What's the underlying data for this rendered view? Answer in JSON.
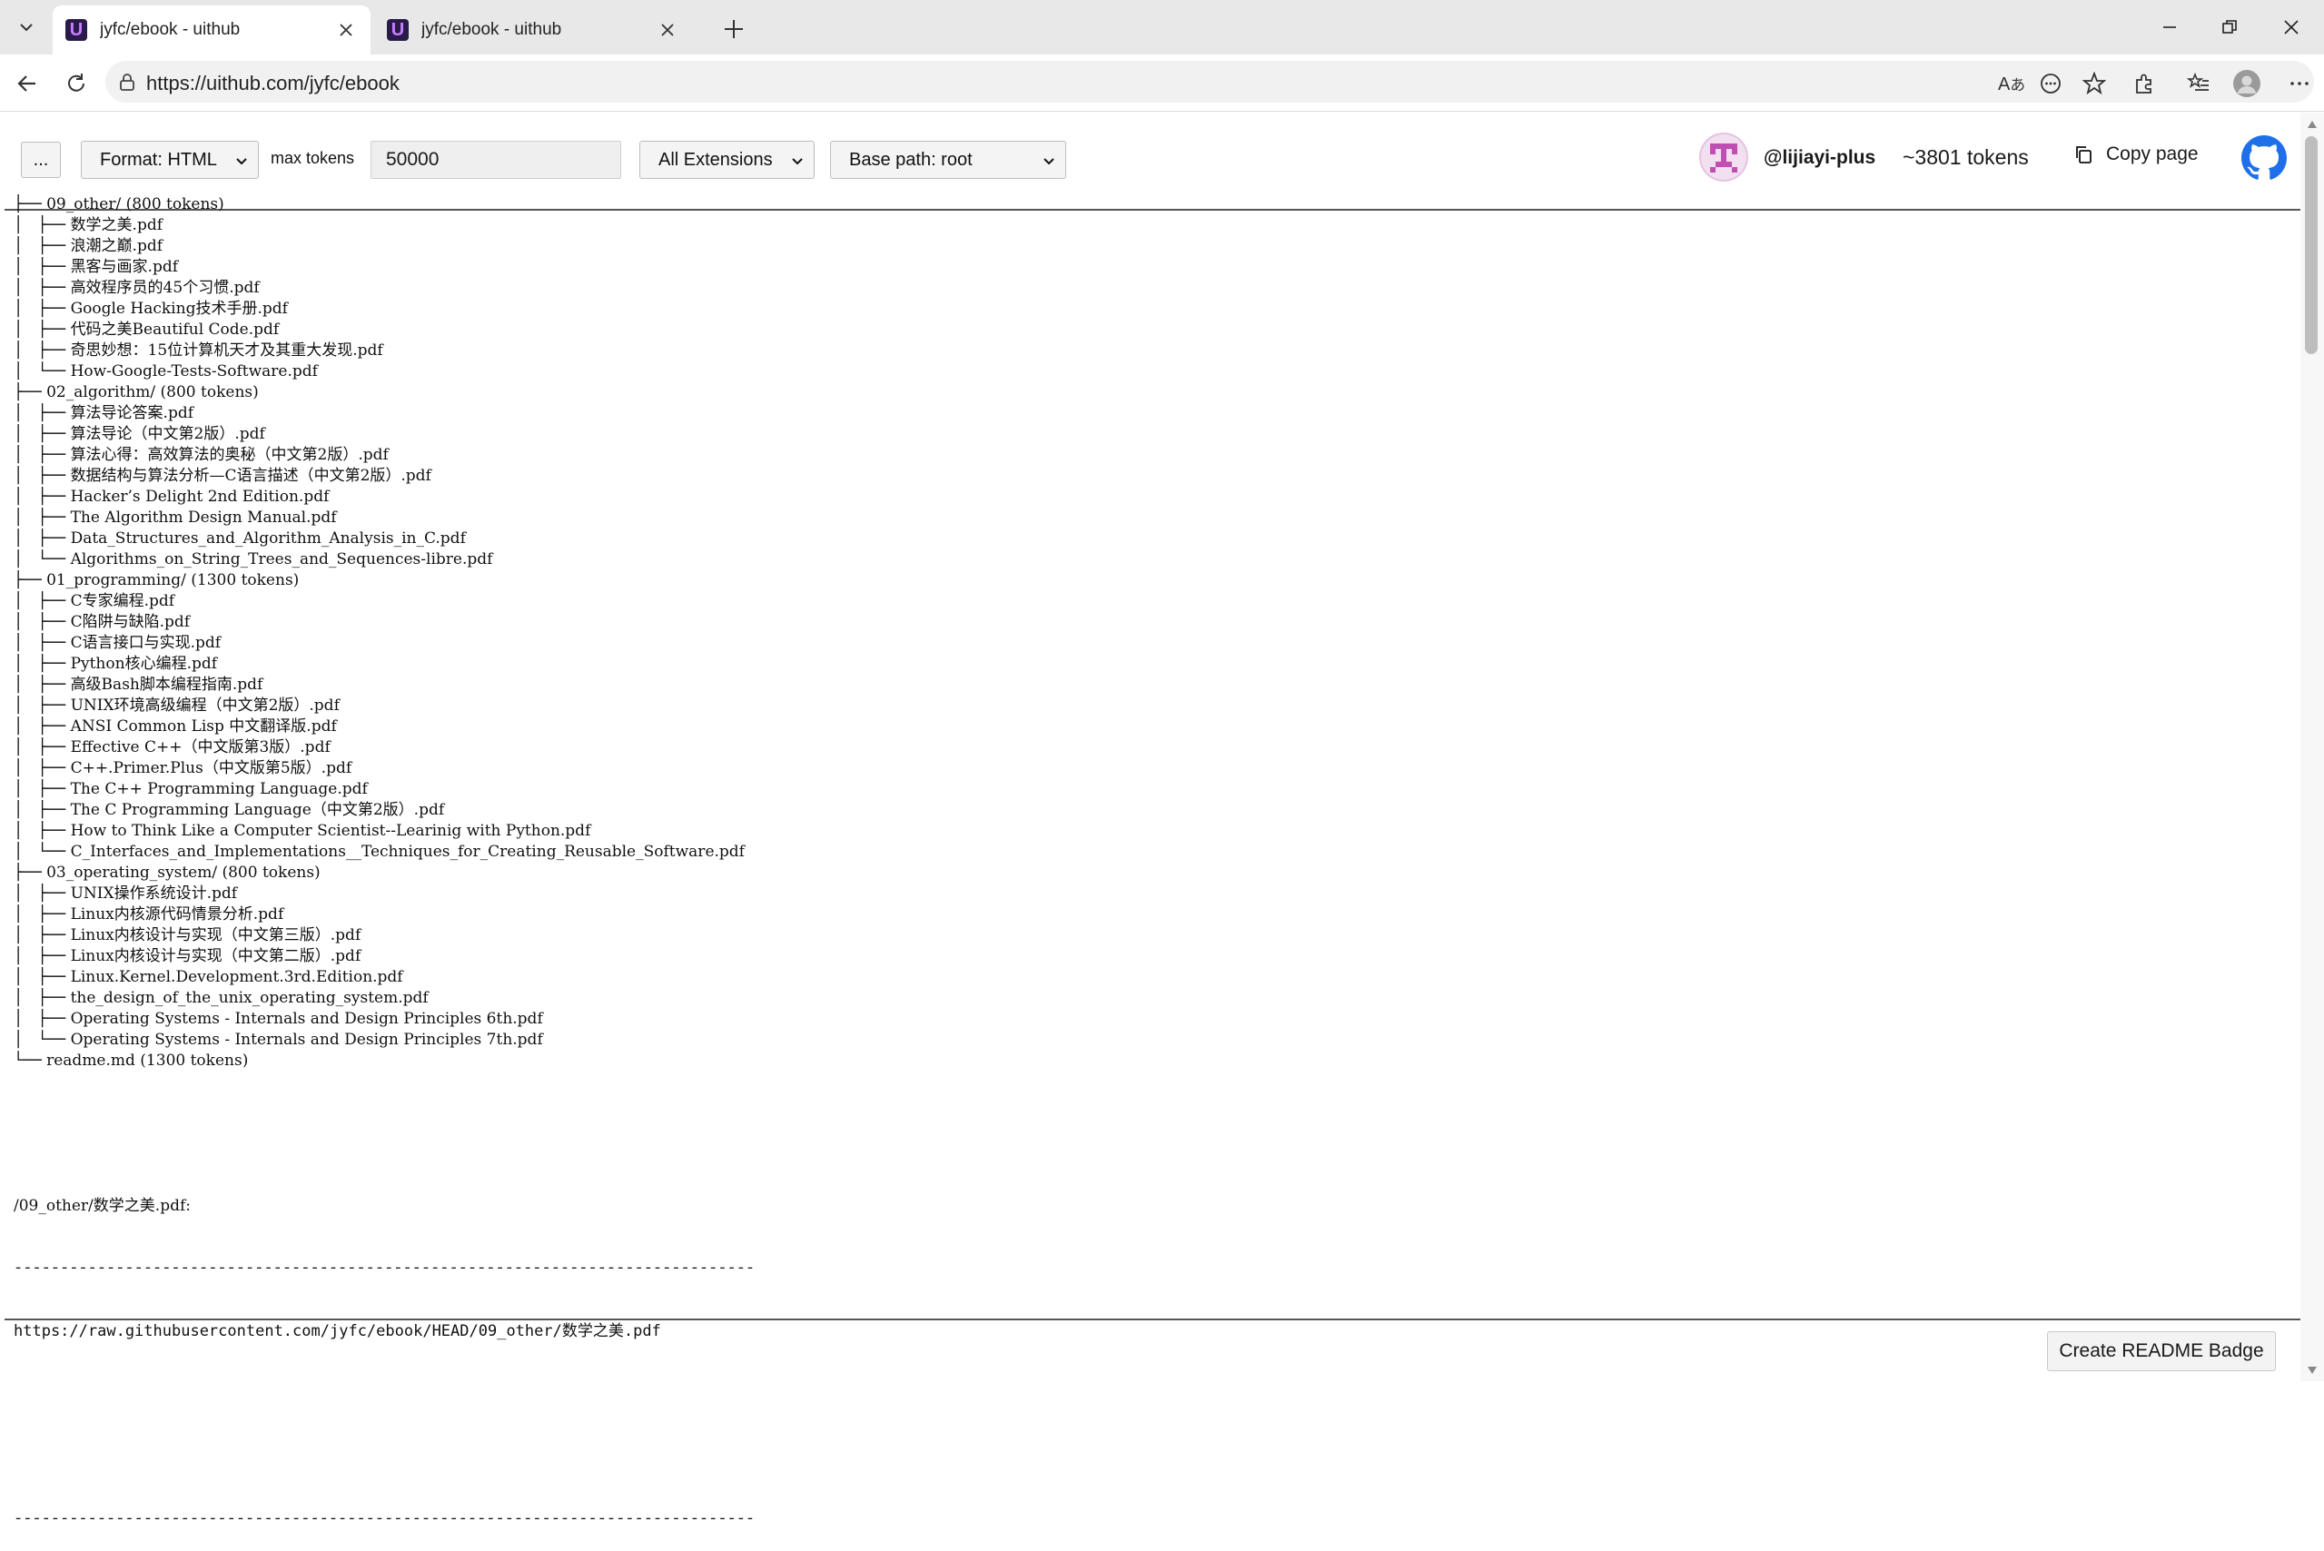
{
  "browser": {
    "tabs": [
      {
        "title": "jyfc/ebook - uithub",
        "favicon": "U",
        "active": true
      },
      {
        "title": "jyfc/ebook - uithub",
        "favicon": "U",
        "active": false
      }
    ],
    "url": "https://uithub.com/jyfc/ebook"
  },
  "toolbar": {
    "more_label": "...",
    "format_label": "Format: HTML",
    "max_tokens_label": "max tokens",
    "max_tokens_value": "50000",
    "extensions_label": "All Extensions",
    "base_path_label": "Base path: root",
    "username": "@lijiayi-plus",
    "token_count": "~3801 tokens",
    "copy_label": "Copy page"
  },
  "tree": [
    {
      "prefix": "├── ",
      "name": "09_other/ (800 tokens)"
    },
    {
      "prefix": "│   ├── ",
      "name": "数学之美.pdf"
    },
    {
      "prefix": "│   ├── ",
      "name": "浪潮之巅.pdf"
    },
    {
      "prefix": "│   ├── ",
      "name": "黑客与画家.pdf"
    },
    {
      "prefix": "│   ├── ",
      "name": "高效程序员的45个习惯.pdf"
    },
    {
      "prefix": "│   ├── ",
      "name": "Google Hacking技术手册.pdf"
    },
    {
      "prefix": "│   ├── ",
      "name": "代码之美Beautiful Code.pdf"
    },
    {
      "prefix": "│   ├── ",
      "name": "奇思妙想：15位计算机天才及其重大发现.pdf"
    },
    {
      "prefix": "│   └── ",
      "name": "How-Google-Tests-Software.pdf"
    },
    {
      "prefix": "├── ",
      "name": "02_algorithm/ (800 tokens)"
    },
    {
      "prefix": "│   ├── ",
      "name": "算法导论答案.pdf"
    },
    {
      "prefix": "│   ├── ",
      "name": "算法导论（中文第2版）.pdf"
    },
    {
      "prefix": "│   ├── ",
      "name": "算法心得：高效算法的奥秘（中文第2版）.pdf"
    },
    {
      "prefix": "│   ├── ",
      "name": "数据结构与算法分析—C语言描述（中文第2版）.pdf"
    },
    {
      "prefix": "│   ├── ",
      "name": "Hacker’s Delight 2nd Edition.pdf"
    },
    {
      "prefix": "│   ├── ",
      "name": "The Algorithm Design Manual.pdf"
    },
    {
      "prefix": "│   ├── ",
      "name": "Data_Structures_and_Algorithm_Analysis_in_C.pdf"
    },
    {
      "prefix": "│   └── ",
      "name": "Algorithms_on_String_Trees_and_Sequences-libre.pdf"
    },
    {
      "prefix": "├── ",
      "name": "01_programming/ (1300 tokens)"
    },
    {
      "prefix": "│   ├── ",
      "name": "C专家编程.pdf"
    },
    {
      "prefix": "│   ├── ",
      "name": "C陷阱与缺陷.pdf"
    },
    {
      "prefix": "│   ├── ",
      "name": "C语言接口与实现.pdf"
    },
    {
      "prefix": "│   ├── ",
      "name": "Python核心编程.pdf"
    },
    {
      "prefix": "│   ├── ",
      "name": "高级Bash脚本编程指南.pdf"
    },
    {
      "prefix": "│   ├── ",
      "name": "UNIX环境高级编程（中文第2版）.pdf"
    },
    {
      "prefix": "│   ├── ",
      "name": "ANSI Common Lisp 中文翻译版.pdf"
    },
    {
      "prefix": "│   ├── ",
      "name": "Effective C++（中文版第3版）.pdf"
    },
    {
      "prefix": "│   ├── ",
      "name": "C++.Primer.Plus（中文版第5版）.pdf"
    },
    {
      "prefix": "│   ├── ",
      "name": "The C++ Programming Language.pdf"
    },
    {
      "prefix": "│   ├── ",
      "name": "The C Programming Language（中文第2版）.pdf"
    },
    {
      "prefix": "│   ├── ",
      "name": "How to Think Like a Computer Scientist--Learinig with Python.pdf"
    },
    {
      "prefix": "│   └── ",
      "name": "C_Interfaces_and_Implementations__Techniques_for_Creating_Reusable_Software.pdf"
    },
    {
      "prefix": "├── ",
      "name": "03_operating_system/ (800 tokens)"
    },
    {
      "prefix": "│   ├── ",
      "name": "UNIX操作系统设计.pdf"
    },
    {
      "prefix": "│   ├── ",
      "name": "Linux内核源代码情景分析.pdf"
    },
    {
      "prefix": "│   ├── ",
      "name": "Linux内核设计与实现（中文第三版）.pdf"
    },
    {
      "prefix": "│   ├── ",
      "name": "Linux内核设计与实现（中文第二版）.pdf"
    },
    {
      "prefix": "│   ├── ",
      "name": "Linux.Kernel.Development.3rd.Edition.pdf"
    },
    {
      "prefix": "│   ├── ",
      "name": "the_design_of_the_unix_operating_system.pdf"
    },
    {
      "prefix": "│   ├── ",
      "name": "Operating Systems - Internals and Design Principles 6th.pdf"
    },
    {
      "prefix": "│   └── ",
      "name": "Operating Systems - Internals and Design Principles 7th.pdf"
    },
    {
      "prefix": "└── ",
      "name": "readme.md (1300 tokens)"
    }
  ],
  "file_section": {
    "path": "/09_other/数学之美.pdf:",
    "separator": "--------------------------------------------------------------------------------",
    "raw_url": "https://raw.githubusercontent.com/jyfc/ebook/HEAD/09_other/数学之美.pdf",
    "separator2": "--------------------------------------------------------------------------------"
  },
  "footer": {
    "readme_badge_label": "Create README Badge"
  },
  "colors": {
    "accent": "#2a1a4a",
    "github": "#1f6feb"
  }
}
